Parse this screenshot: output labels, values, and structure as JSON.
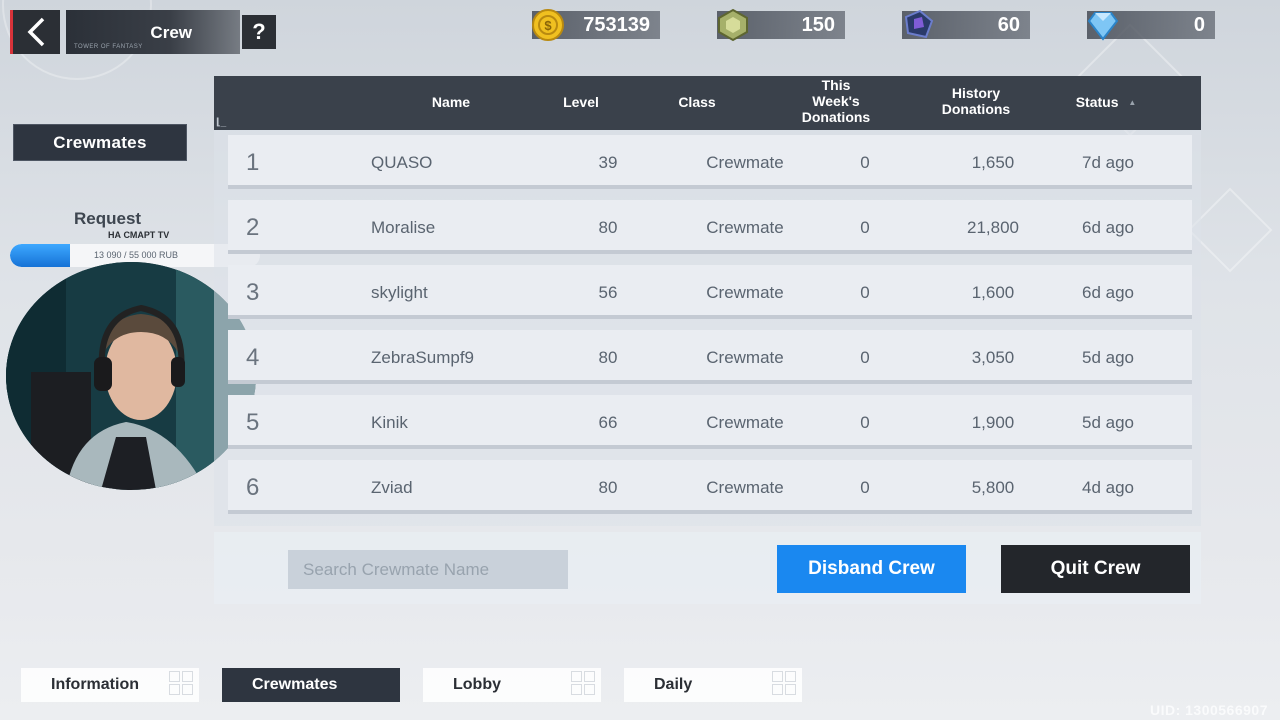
{
  "header": {
    "title": "Crew",
    "subtitle": "TOWER OF FANTASY",
    "help_label": "?"
  },
  "currencies": [
    {
      "icon": "gold-coin-icon",
      "value": "753139"
    },
    {
      "icon": "green-crystal-icon",
      "value": "150"
    },
    {
      "icon": "dark-crystal-icon",
      "value": "60"
    },
    {
      "icon": "blue-diamond-icon",
      "value": "0"
    }
  ],
  "sidebar": {
    "section_label": "Crewmates",
    "request_label": "Request"
  },
  "donation": {
    "title": "НА СМАРТ ТV",
    "progress_text": "13 090 / 55 000 RUB",
    "progress_fraction": 0.238
  },
  "table": {
    "columns": {
      "name": "Name",
      "level": "Level",
      "class": "Class",
      "week_donations_1": "This",
      "week_donations_2": "Week's",
      "week_donations_3": "Donations",
      "history_donations_1": "History",
      "history_donations_2": "Donations",
      "status": "Status",
      "sort_indicator": "▲"
    },
    "rows": [
      {
        "rank": "1",
        "name": "QUASO",
        "level": "39",
        "class": "Crewmate",
        "week": "0",
        "history": "1,650",
        "status": "7d ago"
      },
      {
        "rank": "2",
        "name": "Moralise",
        "level": "80",
        "class": "Crewmate",
        "week": "0",
        "history": "21,800",
        "status": "6d ago"
      },
      {
        "rank": "3",
        "name": "skylight",
        "level": "56",
        "class": "Crewmate",
        "week": "0",
        "history": "1,600",
        "status": "6d ago"
      },
      {
        "rank": "4",
        "name": "ZebraSumpf9",
        "level": "80",
        "class": "Crewmate",
        "week": "0",
        "history": "3,050",
        "status": "5d ago"
      },
      {
        "rank": "5",
        "name": "Kinik",
        "level": "66",
        "class": "Crewmate",
        "week": "0",
        "history": "1,900",
        "status": "5d ago"
      },
      {
        "rank": "6",
        "name": "Zviad",
        "level": "80",
        "class": "Crewmate",
        "week": "0",
        "history": "5,800",
        "status": "4d ago"
      }
    ]
  },
  "footer": {
    "search_placeholder": "Search Crewmate Name",
    "disband_label": "Disband Crew",
    "quit_label": "Quit Crew"
  },
  "tabs": [
    {
      "label": "Information",
      "active": false
    },
    {
      "label": "Crewmates",
      "active": true
    },
    {
      "label": "Lobby",
      "active": false
    },
    {
      "label": "Daily",
      "active": false
    }
  ],
  "uid_text": "UID: 1300566907",
  "colors": {
    "accent_blue": "#1a88f0",
    "dark_panel": "#3a414b",
    "back_accent": "#d8333a"
  }
}
